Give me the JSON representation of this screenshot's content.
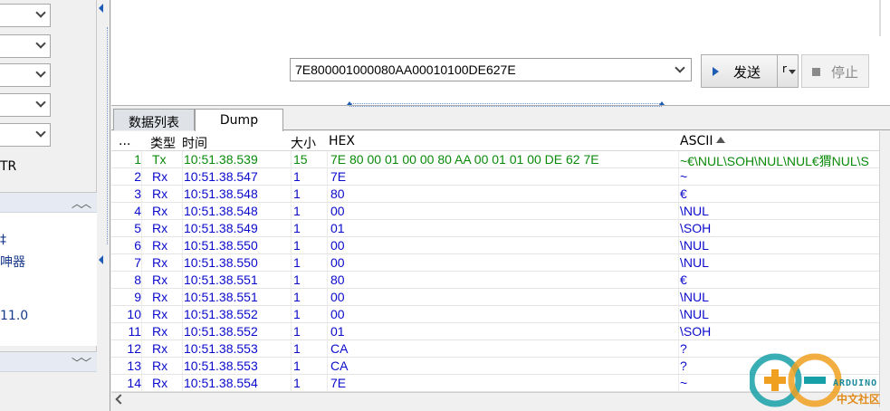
{
  "left_panel": {
    "tr_label": "TR",
    "box_text_1": "‡",
    "box_text_2": "呻器",
    "version": "11.0"
  },
  "send_area": {
    "command_value": "7E800001000080AA00010100DE627E",
    "send_label": "发送",
    "dropdown_label": "r",
    "stop_label": "停止"
  },
  "tabs": [
    {
      "label": "数据列表"
    },
    {
      "label": "Dump"
    }
  ],
  "table": {
    "columns": {
      "idx": "...",
      "type": "类型",
      "time": "时间",
      "size": "大小",
      "hex": "HEX",
      "ascii": "ASCII"
    },
    "rows": [
      {
        "idx": "1",
        "type": "Tx",
        "time": "10:51.38.539",
        "size": "15",
        "hex": "7E 80 00 01 00 00 80 AA 00 01 01 00 DE 62 7E",
        "ascii": "~€\\NUL\\SOH\\NUL\\NUL€猬NUL\\S"
      },
      {
        "idx": "2",
        "type": "Rx",
        "time": "10:51.38.547",
        "size": "1",
        "hex": "7E",
        "ascii": "~"
      },
      {
        "idx": "3",
        "type": "Rx",
        "time": "10:51.38.548",
        "size": "1",
        "hex": "80",
        "ascii": "€"
      },
      {
        "idx": "4",
        "type": "Rx",
        "time": "10:51.38.548",
        "size": "1",
        "hex": "00",
        "ascii": "\\NUL"
      },
      {
        "idx": "5",
        "type": "Rx",
        "time": "10:51.38.549",
        "size": "1",
        "hex": "01",
        "ascii": "\\SOH"
      },
      {
        "idx": "6",
        "type": "Rx",
        "time": "10:51.38.550",
        "size": "1",
        "hex": "00",
        "ascii": "\\NUL"
      },
      {
        "idx": "7",
        "type": "Rx",
        "time": "10:51.38.550",
        "size": "1",
        "hex": "00",
        "ascii": "\\NUL"
      },
      {
        "idx": "8",
        "type": "Rx",
        "time": "10:51.38.551",
        "size": "1",
        "hex": "80",
        "ascii": "€"
      },
      {
        "idx": "9",
        "type": "Rx",
        "time": "10:51.38.551",
        "size": "1",
        "hex": "00",
        "ascii": "\\NUL"
      },
      {
        "idx": "10",
        "type": "Rx",
        "time": "10:51.38.552",
        "size": "1",
        "hex": "00",
        "ascii": "\\NUL"
      },
      {
        "idx": "11",
        "type": "Rx",
        "time": "10:51.38.552",
        "size": "1",
        "hex": "01",
        "ascii": "\\SOH"
      },
      {
        "idx": "12",
        "type": "Rx",
        "time": "10:51.38.553",
        "size": "1",
        "hex": "CA",
        "ascii": "?"
      },
      {
        "idx": "13",
        "type": "Rx",
        "time": "10:51.38.553",
        "size": "1",
        "hex": "CA",
        "ascii": "?"
      },
      {
        "idx": "14",
        "type": "Rx",
        "time": "10:51.38.554",
        "size": "1",
        "hex": "7E",
        "ascii": "~"
      }
    ]
  },
  "watermark": {
    "text": "ARDUINO",
    "sub": "中文社区"
  },
  "colors": {
    "tx": "#0a8a0a",
    "rx": "#0a0acc",
    "accent": "#1e5bb5"
  }
}
